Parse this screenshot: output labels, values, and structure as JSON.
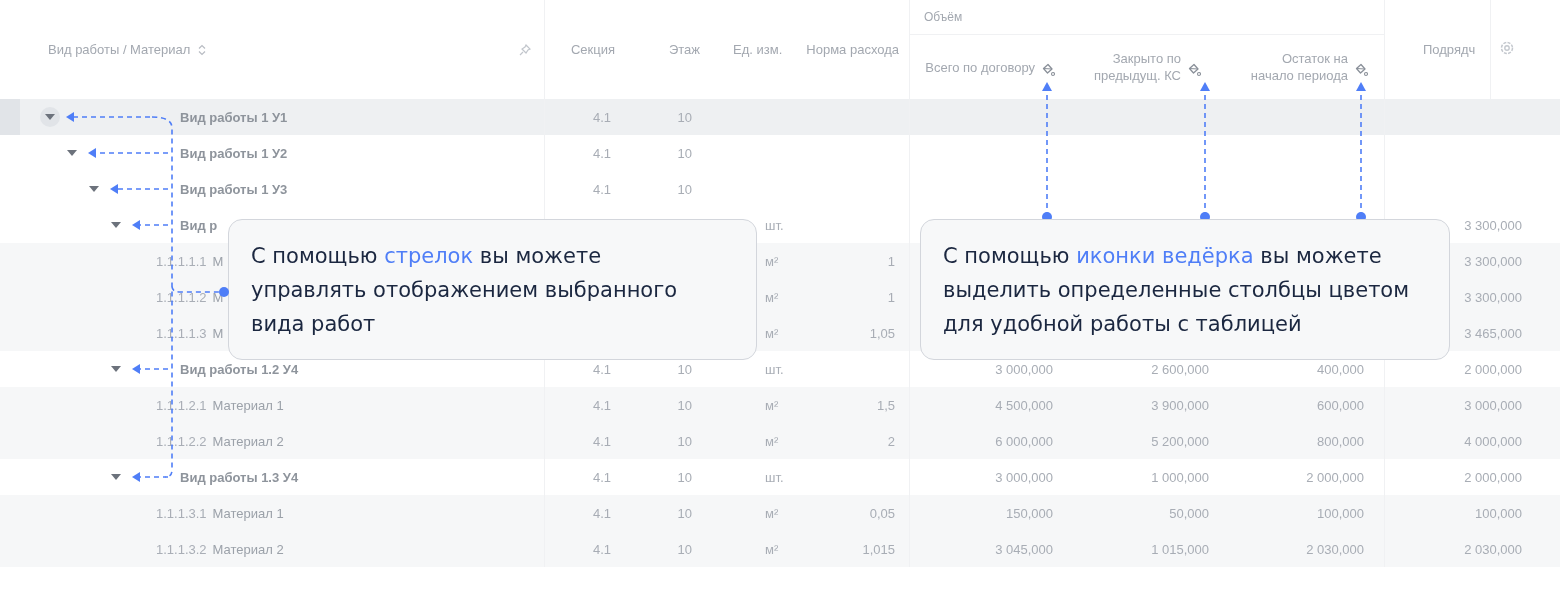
{
  "table": {
    "header": {
      "tree_column": "Вид работы / Материал",
      "columns": [
        "Секция",
        "Этаж",
        "Ед. изм.",
        "Норма расхода"
      ],
      "group": {
        "label": "Объём",
        "columns": [
          "Всего по договору",
          "Закрыто по предыдущ. КС",
          "Остаток на начало периода"
        ]
      },
      "column_9": "Подрядч"
    },
    "rows": [
      {
        "kind": "group",
        "name": "Вид работы 1 У1",
        "expanded": true,
        "selected": true,
        "section": "4.1",
        "floor": "10",
        "children": [
          {
            "kind": "group",
            "name": "Вид работы 1 У2",
            "expanded": true,
            "selected": false,
            "section": "4.1",
            "floor": "10",
            "children": [
              {
                "kind": "group",
                "name": "Вид работы 1 У3",
                "expanded": true,
                "selected": false,
                "section": "4.1",
                "floor": "10",
                "children": [
                  {
                    "kind": "group",
                    "name": "Вид р",
                    "expanded": true,
                    "selected": false,
                    "unit": "шт.",
                    "column_9": "3 300,000",
                    "children": [
                      {
                        "kind": "material",
                        "code": "1.1.1.1.1",
                        "name": "М",
                        "selected": false,
                        "unit": "м²",
                        "norm": "1",
                        "column_9": "3 300,000"
                      },
                      {
                        "kind": "material",
                        "code": "1.1.1.1.2",
                        "name": "М",
                        "selected": false,
                        "unit": "м²",
                        "norm": "1",
                        "column_9": "3 300,000"
                      },
                      {
                        "kind": "material",
                        "code": "1.1.1.1.3",
                        "name": "М",
                        "selected": false,
                        "unit": "м²",
                        "norm": "1,05",
                        "column_9": "3 465,000"
                      }
                    ]
                  },
                  {
                    "kind": "group",
                    "name": "Вид работы 1.2 У4",
                    "expanded": true,
                    "selected": false,
                    "section": "4.1",
                    "floor": "10",
                    "unit": "шт.",
                    "total": "3 000,000",
                    "closed": "2 600,000",
                    "remaining": "400,000",
                    "column_9": "2 000,000",
                    "children": [
                      {
                        "kind": "material",
                        "code": "1.1.1.2.1",
                        "name": "Материал 1",
                        "selected": false,
                        "section": "4.1",
                        "floor": "10",
                        "unit": "м²",
                        "norm": "1,5",
                        "total": "4 500,000",
                        "closed": "3 900,000",
                        "remaining": "600,000",
                        "column_9": "3 000,000"
                      },
                      {
                        "kind": "material",
                        "code": "1.1.1.2.2",
                        "name": "Материал 2",
                        "selected": false,
                        "section": "4.1",
                        "floor": "10",
                        "unit": "м²",
                        "norm": "2",
                        "total": "6 000,000",
                        "closed": "5 200,000",
                        "remaining": "800,000",
                        "column_9": "4 000,000"
                      }
                    ]
                  },
                  {
                    "kind": "group",
                    "name": "Вид работы 1.3 У4",
                    "expanded": true,
                    "selected": false,
                    "section": "4.1",
                    "floor": "10",
                    "unit": "шт.",
                    "total": "3 000,000",
                    "closed": "1 000,000",
                    "remaining": "2 000,000",
                    "column_9": "2 000,000",
                    "children": [
                      {
                        "kind": "material",
                        "code": "1.1.1.3.1",
                        "name": "Материал 1",
                        "selected": false,
                        "section": "4.1",
                        "floor": "10",
                        "unit": "м²",
                        "norm": "0,05",
                        "total": "150,000",
                        "closed": "50,000",
                        "remaining": "100,000",
                        "column_9": "100,000"
                      },
                      {
                        "kind": "material",
                        "code": "1.1.1.3.2",
                        "name": "Материал 2",
                        "selected": false,
                        "section": "4.1",
                        "floor": "10",
                        "unit": "м²",
                        "norm": "1,015",
                        "total": "3 045,000",
                        "closed": "1 015,000",
                        "remaining": "2 030,000",
                        "column_9": "2 030,000"
                      }
                    ]
                  }
                ]
              }
            ]
          }
        ]
      }
    ]
  },
  "callouts": [
    {
      "before": "С помощью ",
      "highlight": "стрелок",
      "after": " вы можете управлять отображением выбранного вида работ"
    },
    {
      "before": "С помощью ",
      "highlight": "иконки ведёрка",
      "after": " вы можете выделить определенные столбцы цветом для удобной работы с таблицей"
    }
  ]
}
